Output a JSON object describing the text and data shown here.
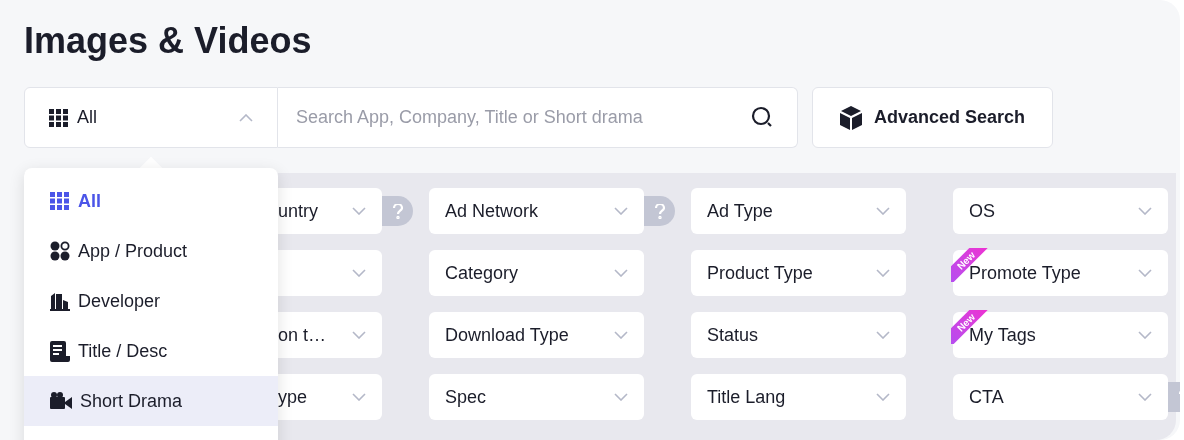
{
  "title": "Images & Videos",
  "scope_select": {
    "value": "All",
    "expanded": true
  },
  "search": {
    "placeholder": "Search App, Company, Title or Short drama"
  },
  "advanced_button": {
    "label": "Advanced Search"
  },
  "filters": [
    [
      {
        "label": "untry",
        "chevron": true,
        "help": true,
        "new": false
      },
      {
        "label": "Ad Network",
        "chevron": true,
        "help": true,
        "new": false
      },
      {
        "label": "Ad Type",
        "chevron": true,
        "help": false,
        "new": false
      },
      {
        "label": "OS",
        "chevron": true,
        "help": false,
        "new": false
      }
    ],
    [
      {
        "chevron": true,
        "help": false,
        "new": false
      },
      {
        "label": "Category",
        "chevron": true,
        "help": false,
        "new": false
      },
      {
        "label": "Product Type",
        "chevron": true,
        "help": false,
        "new": false
      },
      {
        "label": "Promote Type",
        "chevron": true,
        "help": false,
        "new": true,
        "badge": "New"
      }
    ],
    [
      {
        "label": "on t…",
        "chevron": true,
        "help": false,
        "new": false
      },
      {
        "label": "Download Type",
        "chevron": true,
        "help": false,
        "new": false
      },
      {
        "label": "Status",
        "chevron": true,
        "help": false,
        "new": false
      },
      {
        "label": "My Tags",
        "chevron": true,
        "help": false,
        "new": true,
        "badge": "New"
      }
    ],
    [
      {
        "label": "ype",
        "chevron": true,
        "help": false,
        "new": false
      },
      {
        "label": "Spec",
        "chevron": true,
        "help": false,
        "new": false
      },
      {
        "label": "Title Lang",
        "chevron": true,
        "help": false,
        "new": false
      },
      {
        "label": "CTA",
        "chevron": true,
        "help": true,
        "new": false
      }
    ]
  ],
  "scope_menu": [
    {
      "kind": "grid",
      "label": "All",
      "selected": true,
      "highlighted": false
    },
    {
      "kind": "apps",
      "label": "App / Product",
      "selected": false,
      "highlighted": false
    },
    {
      "kind": "building",
      "label": "Developer",
      "selected": false,
      "highlighted": false
    },
    {
      "kind": "document",
      "label": "Title / Desc",
      "selected": false,
      "highlighted": false
    },
    {
      "kind": "camera",
      "label": "Short Drama",
      "selected": false,
      "highlighted": true
    }
  ]
}
